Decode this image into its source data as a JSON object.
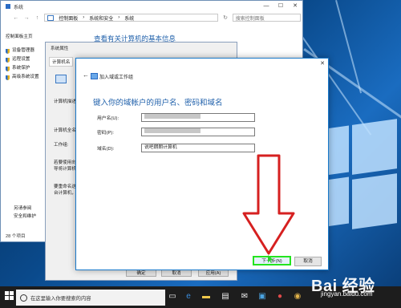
{
  "system_window": {
    "title": "系统",
    "window_controls": [
      "—",
      "☐",
      "✕"
    ],
    "breadcrumb": [
      "控制面板",
      "系统和安全",
      "系统"
    ],
    "search_placeholder": "搜索控制面板",
    "left_nav": {
      "home": "控制面板主页",
      "items": [
        "设备管理器",
        "远程设置",
        "系统保护",
        "高级系统设置"
      ],
      "see_also": "另请参阅",
      "see_also_item": "安全和维护"
    },
    "heading": "查看有关计算机的基本信息",
    "status": "28 个项目"
  },
  "system_properties": {
    "title": "系统属性",
    "tab": "计算机名",
    "labels": [
      "计算机描述",
      "计算机全名",
      "工作组:",
      "若要使用向导将计算机加入域或工作组，请单击“网络 ID”。",
      "要重命名这台计算机，或者更改其域或工作组，请单击“更改”。"
    ],
    "buttons": [
      "确定",
      "取消",
      "应用(A)"
    ]
  },
  "join_domain_dialog": {
    "title": "加入域或工作组",
    "close": "✕",
    "back": "←",
    "heading": "键入你的域帐户的用户名、密码和域名",
    "fields": [
      {
        "label": "用户名(U):",
        "value": ""
      },
      {
        "label": "密码(P):",
        "value": ""
      },
      {
        "label": "域名(D):",
        "value": "说吧朗朗计算机"
      }
    ],
    "next_button": "下一步(N)",
    "cancel_button": "取消"
  },
  "taskbar": {
    "search_text": "在这里输入你要搜索的内容",
    "icons": [
      "windows-start-icon",
      "task-view-icon",
      "edge-icon",
      "explorer-icon",
      "store-icon",
      "mail-icon",
      "photos-icon",
      "media-icon",
      "chrome-icon"
    ]
  },
  "watermark": {
    "brand": "Bai 经验",
    "site": "jingyan.baidu.com"
  },
  "annotation": {
    "arrow_color": "#d62020",
    "highlight_color": "#24e41f"
  }
}
